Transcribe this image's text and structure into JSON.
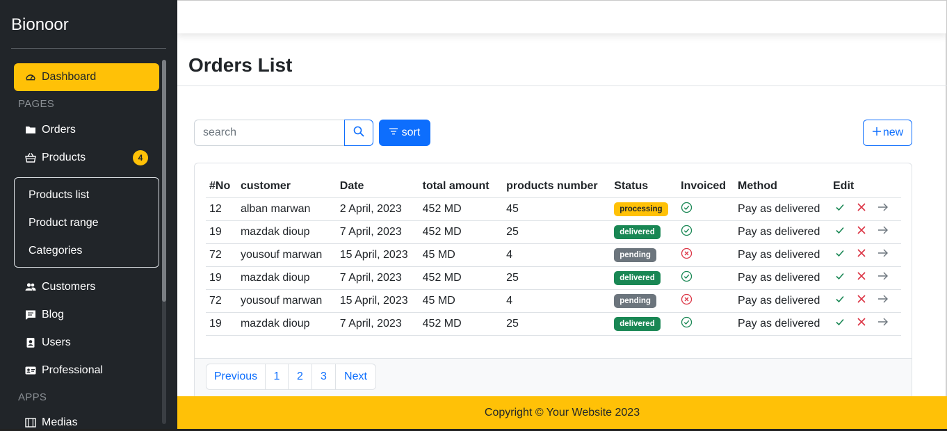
{
  "sidebar": {
    "brand": "Bionoor",
    "dashboard": "Dashboard",
    "pages_label": "PAGES",
    "orders": "Orders",
    "products": "Products",
    "products_badge": "4",
    "submenu": [
      "Products list",
      "Product range",
      "Categories"
    ],
    "customers": "Customers",
    "blog": "Blog",
    "users": "Users",
    "professional": "Professional",
    "apps_label": "APPS",
    "medias": "Medias"
  },
  "main": {
    "title": "Orders List",
    "search_placeholder": "search",
    "sort_label": "sort",
    "new_label": "new"
  },
  "table": {
    "headers": [
      "#No",
      "customer",
      "Date",
      "total amount",
      "products number",
      "Status",
      "Invoiced",
      "Method",
      "Edit"
    ],
    "rows": [
      {
        "no": "12",
        "customer": "alban marwan",
        "date": "2 April, 2023",
        "amount": "452 MD",
        "products": "45",
        "status": "processing",
        "invoiced": true,
        "method": "Pay as delivered"
      },
      {
        "no": "19",
        "customer": "mazdak dioup",
        "date": "7 April, 2023",
        "amount": "452 MD",
        "products": "25",
        "status": "delivered",
        "invoiced": true,
        "method": "Pay as delivered"
      },
      {
        "no": "72",
        "customer": "yousouf marwan",
        "date": "15 April, 2023",
        "amount": "45 MD",
        "products": "4",
        "status": "pending",
        "invoiced": false,
        "method": "Pay as delivered"
      },
      {
        "no": "19",
        "customer": "mazdak dioup",
        "date": "7 April, 2023",
        "amount": "452 MD",
        "products": "25",
        "status": "delivered",
        "invoiced": true,
        "method": "Pay as delivered"
      },
      {
        "no": "72",
        "customer": "yousouf marwan",
        "date": "15 April, 2023",
        "amount": "45 MD",
        "products": "4",
        "status": "pending",
        "invoiced": false,
        "method": "Pay as delivered"
      },
      {
        "no": "19",
        "customer": "mazdak dioup",
        "date": "7 April, 2023",
        "amount": "452 MD",
        "products": "25",
        "status": "delivered",
        "invoiced": true,
        "method": "Pay as delivered"
      }
    ]
  },
  "pagination": {
    "previous": "Previous",
    "pages": [
      "1",
      "2",
      "3"
    ],
    "next": "Next"
  },
  "footer": {
    "copyright": "Copyright © Your Website 2023"
  },
  "colors": {
    "sidebar_bg": "#212529",
    "accent_yellow": "#ffc107",
    "primary_blue": "#0d6efd",
    "success_green": "#198754",
    "danger_red": "#dc3545",
    "secondary_gray": "#6c757d"
  },
  "icons": {
    "dashboard": "speedometer-icon",
    "orders": "folder-icon",
    "products": "basket-icon",
    "customers": "people-icon",
    "blog": "chat-icon",
    "users": "person-badge-icon",
    "professional": "id-card-icon",
    "medias": "film-icon",
    "search": "search-icon",
    "sort": "filter-icon",
    "new": "plus-icon",
    "edit_actions": [
      "check-icon",
      "x-icon",
      "arrow-right-icon"
    ]
  }
}
